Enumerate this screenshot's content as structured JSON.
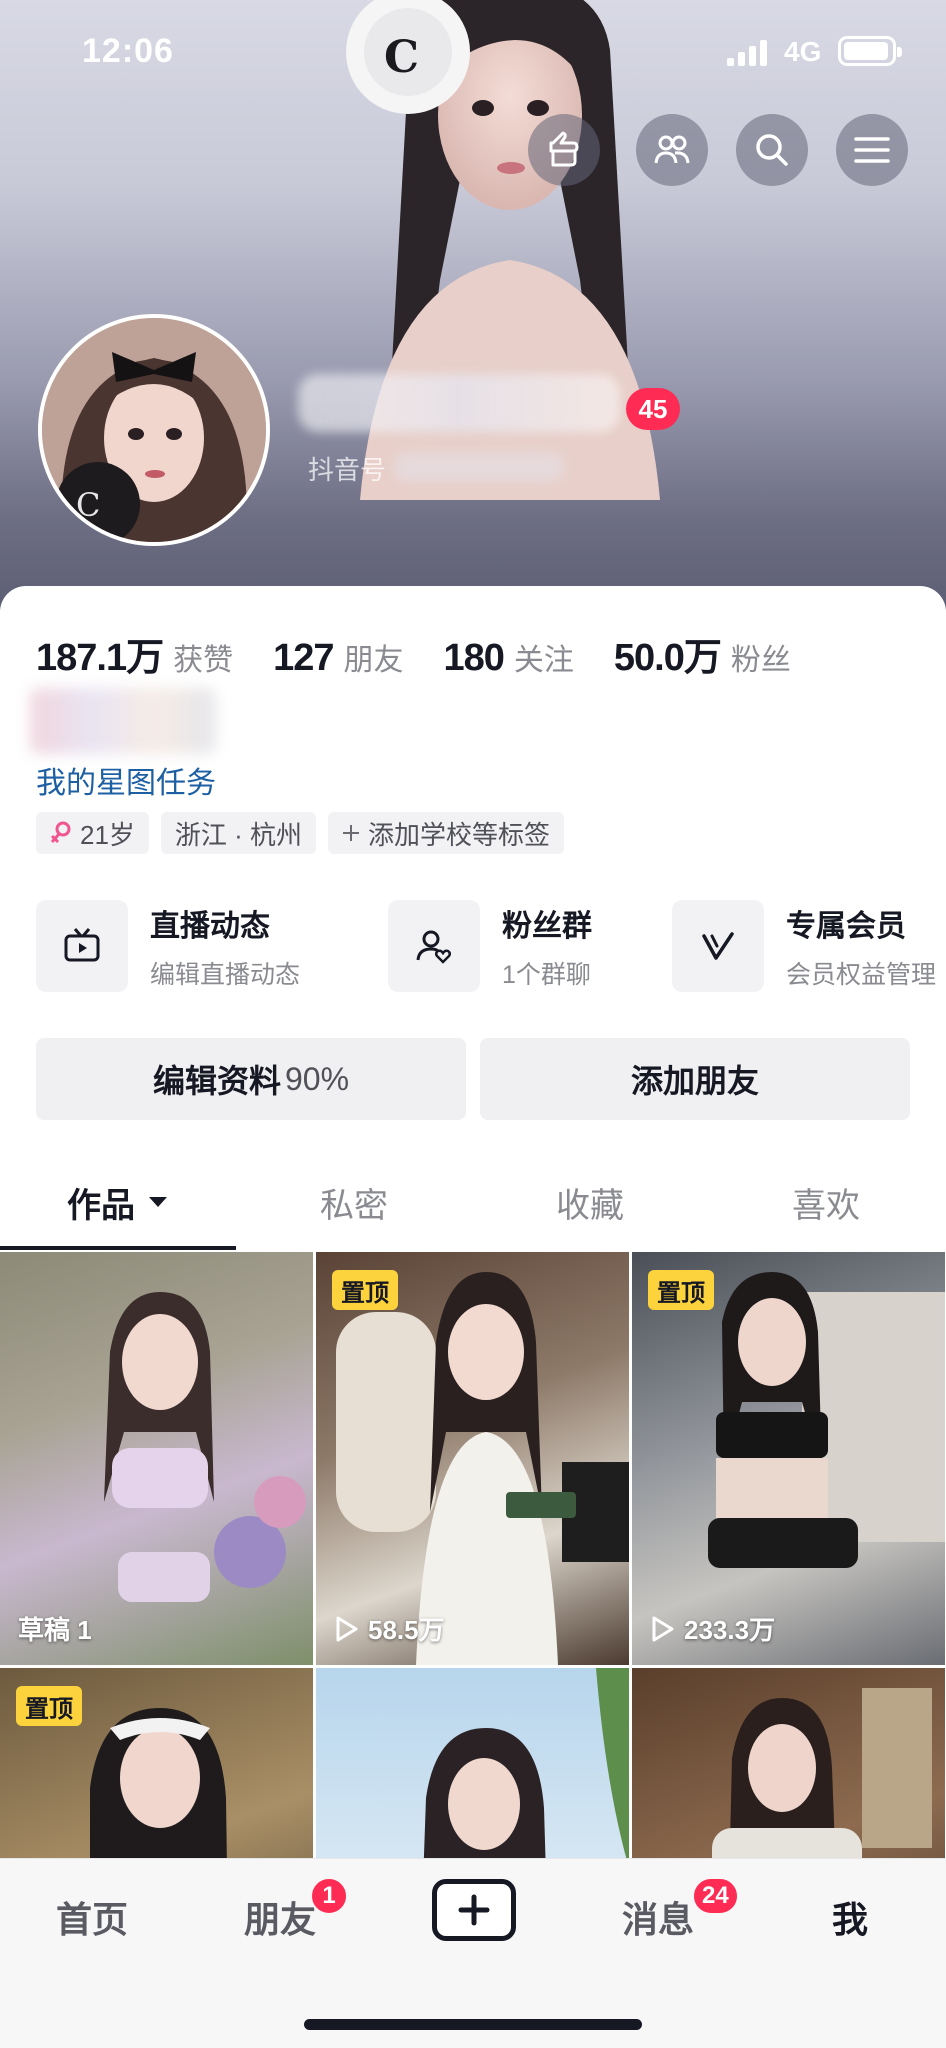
{
  "status_bar": {
    "time": "12:06",
    "network": "4G"
  },
  "header": {
    "level_badge": "45",
    "douyin_id_label": "抖音号"
  },
  "stats": [
    {
      "value": "187.1万",
      "label": "获赞"
    },
    {
      "value": "127",
      "label": "朋友"
    },
    {
      "value": "180",
      "label": "关注"
    },
    {
      "value": "50.0万",
      "label": "粉丝"
    }
  ],
  "profile": {
    "star_task_link": "我的星图任务",
    "tags": {
      "age": "21岁",
      "location": "浙江 · 杭州",
      "add_tag": "添加学校等标签"
    }
  },
  "features": [
    {
      "title": "直播动态",
      "subtitle": "编辑直播动态",
      "icon": "tv-icon"
    },
    {
      "title": "粉丝群",
      "subtitle": "1个群聊",
      "icon": "fan-group-icon"
    },
    {
      "title": "专属会员",
      "subtitle": "会员权益管理",
      "icon": "vip-v-icon"
    }
  ],
  "actions": {
    "edit_profile": "编辑资料",
    "edit_profile_pct": "90%",
    "add_friends": "添加朋友"
  },
  "tabs": [
    "作品",
    "私密",
    "收藏",
    "喜欢"
  ],
  "grid": [
    {
      "pinned": false,
      "caption": "草稿 1",
      "play_icon": false
    },
    {
      "pinned": true,
      "pin_label": "置顶",
      "caption": "58.5万",
      "play_icon": true
    },
    {
      "pinned": true,
      "pin_label": "置顶",
      "caption": "233.3万",
      "play_icon": true
    },
    {
      "pinned": true,
      "pin_label": "置顶",
      "caption": "",
      "play_icon": false
    },
    {
      "pinned": false,
      "caption": "",
      "play_icon": false
    },
    {
      "pinned": false,
      "caption": "",
      "play_icon": false
    }
  ],
  "bottom_nav": {
    "home": "首页",
    "friends": "朋友",
    "friends_badge": "1",
    "messages": "消息",
    "messages_badge": "24",
    "me": "我"
  },
  "colors": {
    "accent_red": "#fe2c55",
    "pin_yellow": "#fcd33c",
    "link_blue": "#1d5fa3",
    "text_dark": "#161823"
  }
}
